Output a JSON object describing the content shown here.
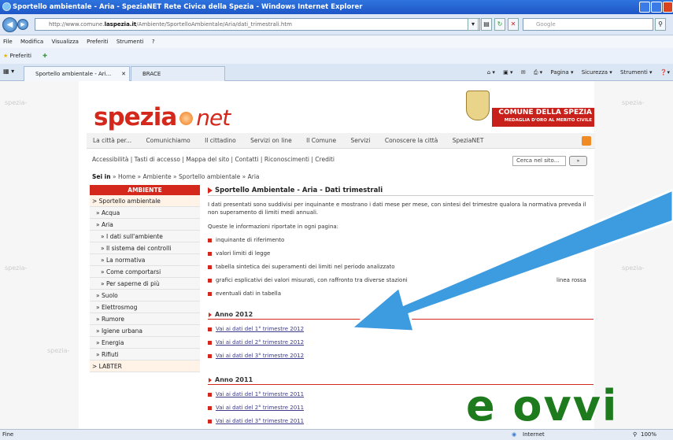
{
  "window": {
    "title": "Sportello ambientale - Aria - SpeziaNET Rete Civica della Spezia - Windows Internet Explorer"
  },
  "browser": {
    "url_pre": "http://www.comune.",
    "url_domain": "laspezia.it",
    "url_post": "/Ambiente/SportelloAmbientale/Aria/dati_trimestrali.htm",
    "search_placeholder": "Google",
    "menu": [
      "File",
      "Modifica",
      "Visualizza",
      "Preferiti",
      "Strumenti",
      "?"
    ],
    "favorites_label": "Preferiti",
    "tabs": [
      {
        "label": "Sportello ambientale - Ari..."
      },
      {
        "label": "BRACE"
      }
    ],
    "commands": [
      "Pagina ▾",
      "Sicurezza ▾",
      "Strumenti ▾"
    ],
    "status_left": "Fine",
    "status_zone": "Internet",
    "zoom": "100%"
  },
  "site": {
    "logo_main": "spezia",
    "logo_net": "net",
    "side_watermark": "spezia-",
    "comune_line1": "COMUNE DELLA SPEZIA",
    "comune_line2": "MEDAGLIA D'ORO AL MERITO CIVILE",
    "nav": [
      "La città per...",
      "Comunichiamo",
      "Il cittadino",
      "Servizi on line",
      "Il Comune",
      "Servizi",
      "Conoscere la città",
      "SpeziaNET"
    ],
    "access": "Accessibilità | Tasti di accesso | Mappa del sito | Contatti | Riconoscimenti | Crediti",
    "search_placeholder": "Cerca nel sito...",
    "search_button": "»",
    "breadcrumb_prefix": "Sei in",
    "breadcrumb_path": " » Home » Ambiente » Sportello ambientale » Aria"
  },
  "sidebar": {
    "header": "AMBIENTE",
    "items": [
      {
        "label": "> Sportello ambientale",
        "level": 0
      },
      {
        "label": "» Acqua",
        "level": 1
      },
      {
        "label": "» Aria",
        "level": 1
      },
      {
        "label": "» I dati sull'ambiente",
        "level": 2
      },
      {
        "label": "» Il sistema dei controlli",
        "level": 2
      },
      {
        "label": "» La normativa",
        "level": 2
      },
      {
        "label": "» Come comportarsi",
        "level": 2
      },
      {
        "label": "» Per saperne di più",
        "level": 2
      },
      {
        "label": "» Suolo",
        "level": 1
      },
      {
        "label": "» Elettrosmog",
        "level": 1
      },
      {
        "label": "» Rumore",
        "level": 1
      },
      {
        "label": "» Igiene urbana",
        "level": 1
      },
      {
        "label": "» Energia",
        "level": 1
      },
      {
        "label": "» Rifiuti",
        "level": 1
      },
      {
        "label": "> LABTER",
        "level": 0
      }
    ]
  },
  "main": {
    "title": "Sportello Ambientale - Aria - Dati trimestrali",
    "intro": "I dati presentati sono suddivisi per inquinante e mostrano i dati mese per mese, con sintesi del trimestre qualora la normativa preveda il non superamento di limiti medi annuali.",
    "intro2": "Queste le informazioni riportate in ogni pagina:",
    "bullets": [
      "inquinante di riferimento",
      "valori limiti di legge",
      "tabella sintetica dei superamenti dei limiti nel periodo analizzato",
      "grafici esplicativi dei valori misurati, con raffronto tra diverse stazioni",
      "eventuali dati in tabella"
    ],
    "bullet4_tail": "linea rossa",
    "years": [
      {
        "label": "Anno 2012",
        "links": [
          "Vai ai dati del 1° trimestre 2012",
          "Vai ai dati del 2° trimestre 2012",
          "Vai ai dati del 3° trimestre 2012"
        ]
      },
      {
        "label": "Anno 2011",
        "links": [
          "Vai ai dati del 1° trimestre 2011",
          "Vai ai dati del 2° trimestre 2011",
          "Vai ai dati del 3° trimestre 2011"
        ]
      }
    ]
  },
  "overlay": {
    "text": "e ovvi",
    "color": "#1d7a1d",
    "arrow_color": "#3d9be0"
  }
}
